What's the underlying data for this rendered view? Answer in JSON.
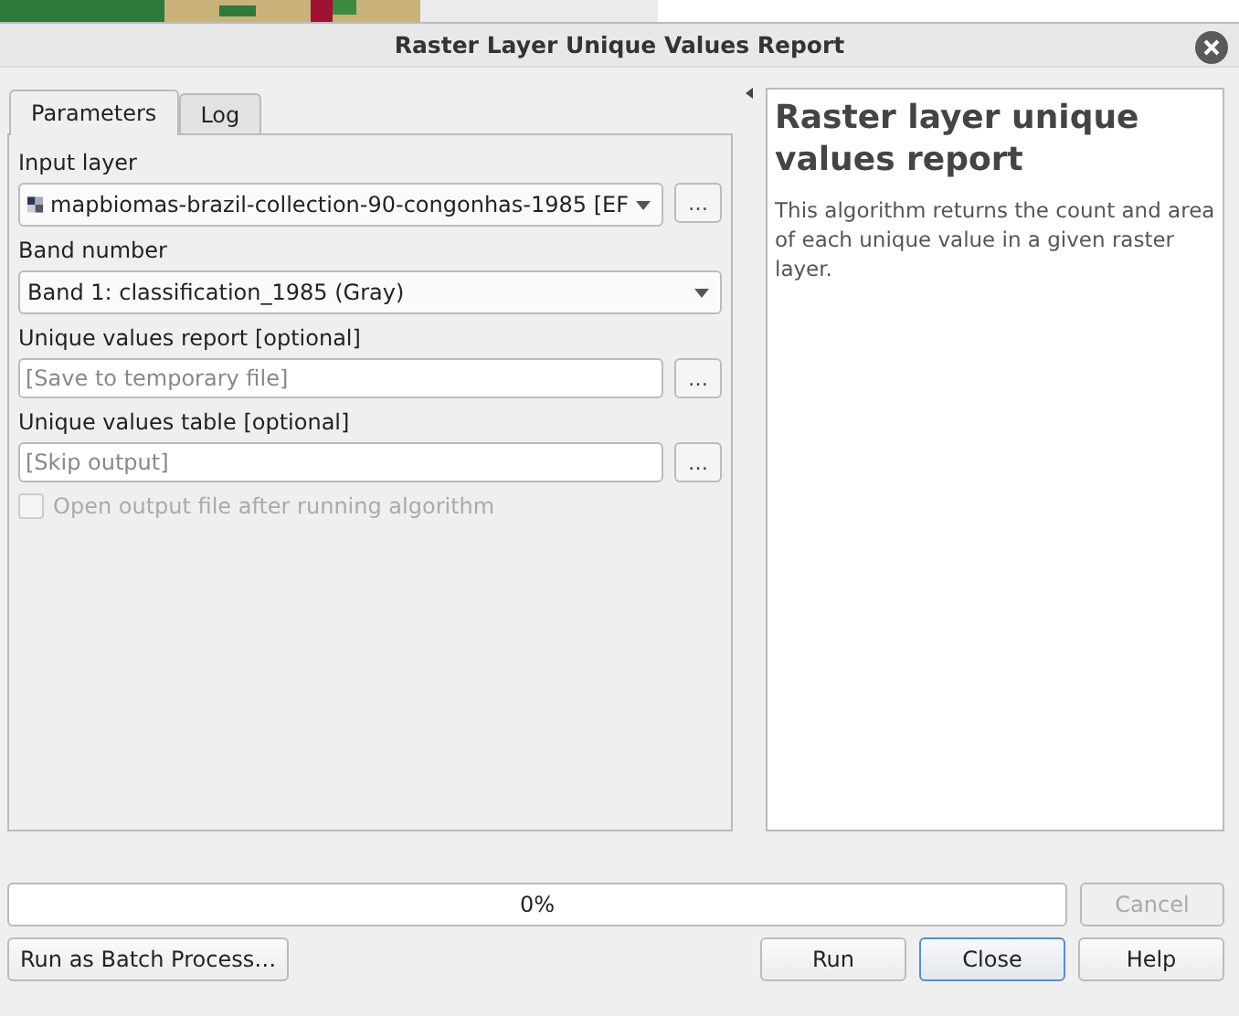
{
  "window": {
    "title": "Raster Layer Unique Values Report"
  },
  "tabs": [
    {
      "label": "Parameters",
      "selected": true
    },
    {
      "label": "Log",
      "selected": false
    }
  ],
  "parameters": [
    {
      "kind": "layer",
      "label": "Input layer",
      "value": "mapbiomas-brazil-collection-90-congonhas-1985 [EF",
      "button": "…"
    },
    {
      "kind": "select",
      "label": "Band number",
      "value": "Band 1: classification_1985 (Gray)"
    },
    {
      "kind": "output",
      "label": "Unique values report [optional]",
      "placeholder": "[Save to temporary file]",
      "button": "…"
    },
    {
      "kind": "output",
      "label": "Unique values table [optional]",
      "placeholder": "[Skip output]",
      "button": "…"
    },
    {
      "kind": "checkbox",
      "label": "Open output file after running algorithm",
      "checked": false,
      "disabled": true
    }
  ],
  "help": {
    "title": "Raster layer unique values report",
    "text": "This algorithm returns the count and area of each unique value in a given raster layer."
  },
  "progress": {
    "level": 0,
    "label": "0%"
  },
  "buttons": [
    {
      "label": "Cancel",
      "disabled": true,
      "default": false
    },
    {
      "label": "Run as Batch Process…",
      "disabled": false,
      "default": false
    },
    {
      "label": "Run",
      "disabled": false,
      "default": false
    },
    {
      "label": "Close",
      "disabled": false,
      "default": true
    },
    {
      "label": "Help",
      "disabled": false,
      "default": false
    }
  ]
}
